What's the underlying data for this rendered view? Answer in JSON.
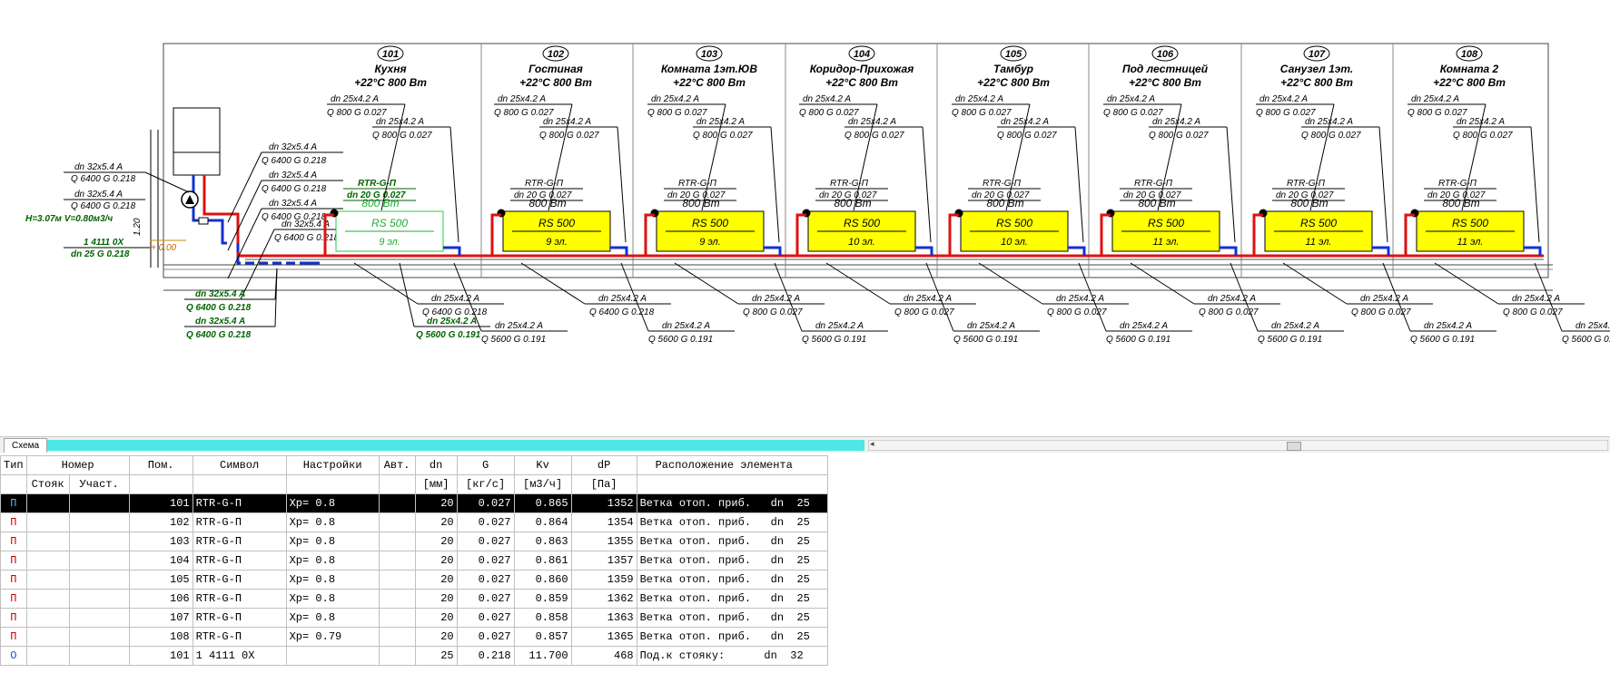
{
  "rooms": [
    {
      "num": "101",
      "name": "Кухня",
      "temp": "+22°C 800 Вт"
    },
    {
      "num": "102",
      "name": "Гостиная",
      "temp": "+22°C 800 Вт"
    },
    {
      "num": "103",
      "name": "Комната 1эт.ЮВ",
      "temp": "+22°C 800 Вт"
    },
    {
      "num": "104",
      "name": "Коридор-Прихожая",
      "temp": "+22°C 800 Вт"
    },
    {
      "num": "105",
      "name": "Тамбур",
      "temp": "+22°C 800 Вт"
    },
    {
      "num": "106",
      "name": "Под лестницей",
      "temp": "+22°C 800 Вт"
    },
    {
      "num": "107",
      "name": "Санузел 1эт.",
      "temp": "+22°C 800 Вт"
    },
    {
      "num": "108",
      "name": "Комната 2",
      "temp": "+22°C 800 Вт"
    }
  ],
  "radiators": [
    {
      "model": "RS 500",
      "sections": "9 эл.",
      "power": "800 Вт",
      "valve": "RTR-G-П",
      "valve_spec": "dn 20  G 0.027"
    },
    {
      "model": "RS 500",
      "sections": "9 эл.",
      "power": "800 Вт",
      "valve": "RTR-G-П",
      "valve_spec": "dn 20  G 0.027"
    },
    {
      "model": "RS 500",
      "sections": "9 эл.",
      "power": "800 Вт",
      "valve": "RTR-G-П",
      "valve_spec": "dn 20  G 0.027"
    },
    {
      "model": "RS 500",
      "sections": "10 эл.",
      "power": "800 Вт",
      "valve": "RTR-G-П",
      "valve_spec": "dn 20  G 0.027"
    },
    {
      "model": "RS 500",
      "sections": "10 эл.",
      "power": "800 Вт",
      "valve": "RTR-G-П",
      "valve_spec": "dn 20  G 0.027"
    },
    {
      "model": "RS 500",
      "sections": "11 эл.",
      "power": "800 Вт",
      "valve": "RTR-G-П",
      "valve_spec": "dn 20  G 0.027"
    },
    {
      "model": "RS 500",
      "sections": "11 эл.",
      "power": "800 Вт",
      "valve": "RTR-G-П",
      "valve_spec": "dn 20  G 0.027"
    },
    {
      "model": "RS 500",
      "sections": "11 эл.",
      "power": "800 Вт",
      "valve": "RTR-G-П",
      "valve_spec": "dn 20  G 0.027"
    }
  ],
  "pipe_labels": {
    "branch_dn": "dn 25x4.2 A",
    "branch_q": "Q 800  G 0.027",
    "main_dn": "dn 32x5.4 A",
    "main_q": "Q 6400  G 0.218",
    "main25_q": "Q 6400  G 0.218",
    "return_q": "Q 5600  G 0.191",
    "pump_head": "H=3.07м  V=0.80м3/ч",
    "balancing_valve": "1 4111 0X",
    "balancing_spec": "dn 25  G 0.218",
    "level": "+ 0.00",
    "height": "1.20"
  },
  "tab_label": "Схема",
  "table": {
    "headers": [
      "Тип",
      "Номер",
      "Пом.",
      "Символ",
      "Настройки",
      "Авт.",
      "dn",
      "G",
      "Kv",
      "dP",
      "Расположение элемента"
    ],
    "subheaders": [
      "Стояк",
      "Участ.",
      "[мм]",
      "[кг/с]",
      "[м3/ч]",
      "[Па]"
    ],
    "rows": [
      {
        "type": "П",
        "stoyak": "",
        "uchast": "",
        "room": "101",
        "symbol": "RTR-G-П",
        "setting": "Xp= 0.8",
        "auto": "",
        "dn": "20",
        "g": "0.027",
        "kv": "0.865",
        "dp": "1352",
        "location": "Ветка отоп. приб.   dn  25",
        "selected": true
      },
      {
        "type": "П",
        "stoyak": "",
        "uchast": "",
        "room": "102",
        "symbol": "RTR-G-П",
        "setting": "Xp= 0.8",
        "auto": "",
        "dn": "20",
        "g": "0.027",
        "kv": "0.864",
        "dp": "1354",
        "location": "Ветка отоп. приб.   dn  25",
        "selected": false
      },
      {
        "type": "П",
        "stoyak": "",
        "uchast": "",
        "room": "103",
        "symbol": "RTR-G-П",
        "setting": "Xp= 0.8",
        "auto": "",
        "dn": "20",
        "g": "0.027",
        "kv": "0.863",
        "dp": "1355",
        "location": "Ветка отоп. приб.   dn  25",
        "selected": false
      },
      {
        "type": "П",
        "stoyak": "",
        "uchast": "",
        "room": "104",
        "symbol": "RTR-G-П",
        "setting": "Xp= 0.8",
        "auto": "",
        "dn": "20",
        "g": "0.027",
        "kv": "0.861",
        "dp": "1357",
        "location": "Ветка отоп. приб.   dn  25",
        "selected": false
      },
      {
        "type": "П",
        "stoyak": "",
        "uchast": "",
        "room": "105",
        "symbol": "RTR-G-П",
        "setting": "Xp= 0.8",
        "auto": "",
        "dn": "20",
        "g": "0.027",
        "kv": "0.860",
        "dp": "1359",
        "location": "Ветка отоп. приб.   dn  25",
        "selected": false
      },
      {
        "type": "П",
        "stoyak": "",
        "uchast": "",
        "room": "106",
        "symbol": "RTR-G-П",
        "setting": "Xp= 0.8",
        "auto": "",
        "dn": "20",
        "g": "0.027",
        "kv": "0.859",
        "dp": "1362",
        "location": "Ветка отоп. приб.   dn  25",
        "selected": false
      },
      {
        "type": "П",
        "stoyak": "",
        "uchast": "",
        "room": "107",
        "symbol": "RTR-G-П",
        "setting": "Xp= 0.8",
        "auto": "",
        "dn": "20",
        "g": "0.027",
        "kv": "0.858",
        "dp": "1363",
        "location": "Ветка отоп. приб.   dn  25",
        "selected": false
      },
      {
        "type": "П",
        "stoyak": "",
        "uchast": "",
        "room": "108",
        "symbol": "RTR-G-П",
        "setting": "Xp= 0.79",
        "auto": "",
        "dn": "20",
        "g": "0.027",
        "kv": "0.857",
        "dp": "1365",
        "location": "Ветка отоп. приб.   dn  25",
        "selected": false
      },
      {
        "type": "О",
        "stoyak": "",
        "uchast": "",
        "room": "101",
        "symbol": "1 4111 0X",
        "setting": "",
        "auto": "",
        "dn": "25",
        "g": "0.218",
        "kv": "11.700",
        "dp": "468",
        "location": "Под.к стояку:      dn  32",
        "selected": false
      }
    ]
  },
  "colors": {
    "supply": "#dd1111",
    "return": "#1133cc",
    "radiator_fill": "#ffff00",
    "radiator_border": "#000000",
    "radiator_selected_border": "#22cc44",
    "selected_text": "#22aa33",
    "label_green": "#006400",
    "tab_strip": "#50e6e6"
  }
}
